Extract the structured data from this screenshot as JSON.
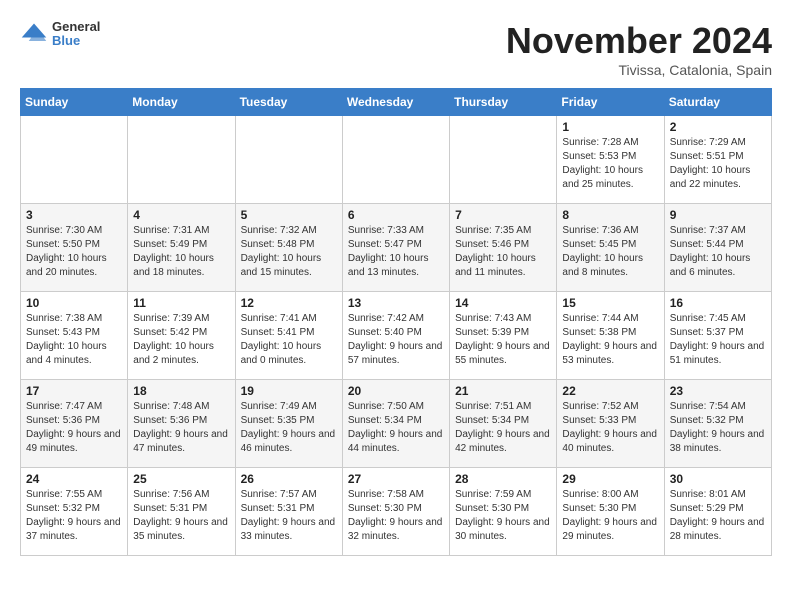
{
  "header": {
    "logo": {
      "line1": "General",
      "line2": "Blue"
    },
    "title": "November 2024",
    "location": "Tivissa, Catalonia, Spain"
  },
  "weekdays": [
    "Sunday",
    "Monday",
    "Tuesday",
    "Wednesday",
    "Thursday",
    "Friday",
    "Saturday"
  ],
  "weeks": [
    [
      {
        "day": "",
        "info": ""
      },
      {
        "day": "",
        "info": ""
      },
      {
        "day": "",
        "info": ""
      },
      {
        "day": "",
        "info": ""
      },
      {
        "day": "",
        "info": ""
      },
      {
        "day": "1",
        "info": "Sunrise: 7:28 AM\nSunset: 5:53 PM\nDaylight: 10 hours and 25 minutes."
      },
      {
        "day": "2",
        "info": "Sunrise: 7:29 AM\nSunset: 5:51 PM\nDaylight: 10 hours and 22 minutes."
      }
    ],
    [
      {
        "day": "3",
        "info": "Sunrise: 7:30 AM\nSunset: 5:50 PM\nDaylight: 10 hours and 20 minutes."
      },
      {
        "day": "4",
        "info": "Sunrise: 7:31 AM\nSunset: 5:49 PM\nDaylight: 10 hours and 18 minutes."
      },
      {
        "day": "5",
        "info": "Sunrise: 7:32 AM\nSunset: 5:48 PM\nDaylight: 10 hours and 15 minutes."
      },
      {
        "day": "6",
        "info": "Sunrise: 7:33 AM\nSunset: 5:47 PM\nDaylight: 10 hours and 13 minutes."
      },
      {
        "day": "7",
        "info": "Sunrise: 7:35 AM\nSunset: 5:46 PM\nDaylight: 10 hours and 11 minutes."
      },
      {
        "day": "8",
        "info": "Sunrise: 7:36 AM\nSunset: 5:45 PM\nDaylight: 10 hours and 8 minutes."
      },
      {
        "day": "9",
        "info": "Sunrise: 7:37 AM\nSunset: 5:44 PM\nDaylight: 10 hours and 6 minutes."
      }
    ],
    [
      {
        "day": "10",
        "info": "Sunrise: 7:38 AM\nSunset: 5:43 PM\nDaylight: 10 hours and 4 minutes."
      },
      {
        "day": "11",
        "info": "Sunrise: 7:39 AM\nSunset: 5:42 PM\nDaylight: 10 hours and 2 minutes."
      },
      {
        "day": "12",
        "info": "Sunrise: 7:41 AM\nSunset: 5:41 PM\nDaylight: 10 hours and 0 minutes."
      },
      {
        "day": "13",
        "info": "Sunrise: 7:42 AM\nSunset: 5:40 PM\nDaylight: 9 hours and 57 minutes."
      },
      {
        "day": "14",
        "info": "Sunrise: 7:43 AM\nSunset: 5:39 PM\nDaylight: 9 hours and 55 minutes."
      },
      {
        "day": "15",
        "info": "Sunrise: 7:44 AM\nSunset: 5:38 PM\nDaylight: 9 hours and 53 minutes."
      },
      {
        "day": "16",
        "info": "Sunrise: 7:45 AM\nSunset: 5:37 PM\nDaylight: 9 hours and 51 minutes."
      }
    ],
    [
      {
        "day": "17",
        "info": "Sunrise: 7:47 AM\nSunset: 5:36 PM\nDaylight: 9 hours and 49 minutes."
      },
      {
        "day": "18",
        "info": "Sunrise: 7:48 AM\nSunset: 5:36 PM\nDaylight: 9 hours and 47 minutes."
      },
      {
        "day": "19",
        "info": "Sunrise: 7:49 AM\nSunset: 5:35 PM\nDaylight: 9 hours and 46 minutes."
      },
      {
        "day": "20",
        "info": "Sunrise: 7:50 AM\nSunset: 5:34 PM\nDaylight: 9 hours and 44 minutes."
      },
      {
        "day": "21",
        "info": "Sunrise: 7:51 AM\nSunset: 5:34 PM\nDaylight: 9 hours and 42 minutes."
      },
      {
        "day": "22",
        "info": "Sunrise: 7:52 AM\nSunset: 5:33 PM\nDaylight: 9 hours and 40 minutes."
      },
      {
        "day": "23",
        "info": "Sunrise: 7:54 AM\nSunset: 5:32 PM\nDaylight: 9 hours and 38 minutes."
      }
    ],
    [
      {
        "day": "24",
        "info": "Sunrise: 7:55 AM\nSunset: 5:32 PM\nDaylight: 9 hours and 37 minutes."
      },
      {
        "day": "25",
        "info": "Sunrise: 7:56 AM\nSunset: 5:31 PM\nDaylight: 9 hours and 35 minutes."
      },
      {
        "day": "26",
        "info": "Sunrise: 7:57 AM\nSunset: 5:31 PM\nDaylight: 9 hours and 33 minutes."
      },
      {
        "day": "27",
        "info": "Sunrise: 7:58 AM\nSunset: 5:30 PM\nDaylight: 9 hours and 32 minutes."
      },
      {
        "day": "28",
        "info": "Sunrise: 7:59 AM\nSunset: 5:30 PM\nDaylight: 9 hours and 30 minutes."
      },
      {
        "day": "29",
        "info": "Sunrise: 8:00 AM\nSunset: 5:30 PM\nDaylight: 9 hours and 29 minutes."
      },
      {
        "day": "30",
        "info": "Sunrise: 8:01 AM\nSunset: 5:29 PM\nDaylight: 9 hours and 28 minutes."
      }
    ]
  ]
}
